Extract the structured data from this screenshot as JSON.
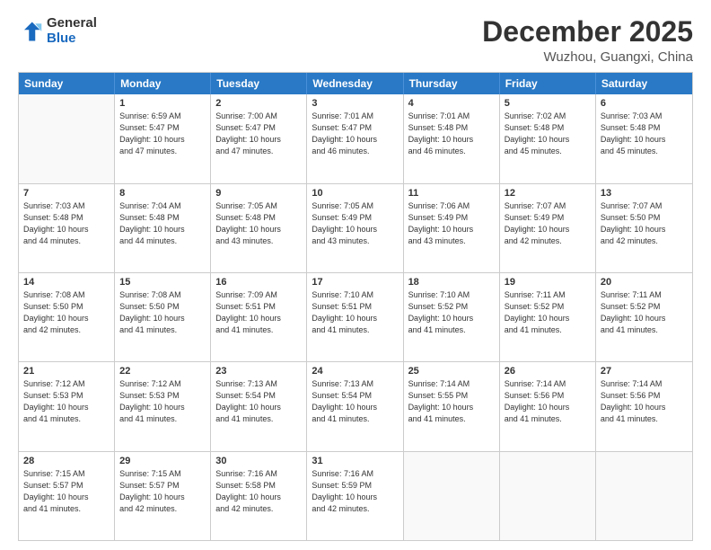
{
  "logo": {
    "general": "General",
    "blue": "Blue"
  },
  "header": {
    "month": "December 2025",
    "location": "Wuzhou, Guangxi, China"
  },
  "days": [
    "Sunday",
    "Monday",
    "Tuesday",
    "Wednesday",
    "Thursday",
    "Friday",
    "Saturday"
  ],
  "weeks": [
    [
      {
        "day": "",
        "info": ""
      },
      {
        "day": "1",
        "info": "Sunrise: 6:59 AM\nSunset: 5:47 PM\nDaylight: 10 hours\nand 47 minutes."
      },
      {
        "day": "2",
        "info": "Sunrise: 7:00 AM\nSunset: 5:47 PM\nDaylight: 10 hours\nand 47 minutes."
      },
      {
        "day": "3",
        "info": "Sunrise: 7:01 AM\nSunset: 5:47 PM\nDaylight: 10 hours\nand 46 minutes."
      },
      {
        "day": "4",
        "info": "Sunrise: 7:01 AM\nSunset: 5:48 PM\nDaylight: 10 hours\nand 46 minutes."
      },
      {
        "day": "5",
        "info": "Sunrise: 7:02 AM\nSunset: 5:48 PM\nDaylight: 10 hours\nand 45 minutes."
      },
      {
        "day": "6",
        "info": "Sunrise: 7:03 AM\nSunset: 5:48 PM\nDaylight: 10 hours\nand 45 minutes."
      }
    ],
    [
      {
        "day": "7",
        "info": "Sunrise: 7:03 AM\nSunset: 5:48 PM\nDaylight: 10 hours\nand 44 minutes."
      },
      {
        "day": "8",
        "info": "Sunrise: 7:04 AM\nSunset: 5:48 PM\nDaylight: 10 hours\nand 44 minutes."
      },
      {
        "day": "9",
        "info": "Sunrise: 7:05 AM\nSunset: 5:48 PM\nDaylight: 10 hours\nand 43 minutes."
      },
      {
        "day": "10",
        "info": "Sunrise: 7:05 AM\nSunset: 5:49 PM\nDaylight: 10 hours\nand 43 minutes."
      },
      {
        "day": "11",
        "info": "Sunrise: 7:06 AM\nSunset: 5:49 PM\nDaylight: 10 hours\nand 43 minutes."
      },
      {
        "day": "12",
        "info": "Sunrise: 7:07 AM\nSunset: 5:49 PM\nDaylight: 10 hours\nand 42 minutes."
      },
      {
        "day": "13",
        "info": "Sunrise: 7:07 AM\nSunset: 5:50 PM\nDaylight: 10 hours\nand 42 minutes."
      }
    ],
    [
      {
        "day": "14",
        "info": "Sunrise: 7:08 AM\nSunset: 5:50 PM\nDaylight: 10 hours\nand 42 minutes."
      },
      {
        "day": "15",
        "info": "Sunrise: 7:08 AM\nSunset: 5:50 PM\nDaylight: 10 hours\nand 41 minutes."
      },
      {
        "day": "16",
        "info": "Sunrise: 7:09 AM\nSunset: 5:51 PM\nDaylight: 10 hours\nand 41 minutes."
      },
      {
        "day": "17",
        "info": "Sunrise: 7:10 AM\nSunset: 5:51 PM\nDaylight: 10 hours\nand 41 minutes."
      },
      {
        "day": "18",
        "info": "Sunrise: 7:10 AM\nSunset: 5:52 PM\nDaylight: 10 hours\nand 41 minutes."
      },
      {
        "day": "19",
        "info": "Sunrise: 7:11 AM\nSunset: 5:52 PM\nDaylight: 10 hours\nand 41 minutes."
      },
      {
        "day": "20",
        "info": "Sunrise: 7:11 AM\nSunset: 5:52 PM\nDaylight: 10 hours\nand 41 minutes."
      }
    ],
    [
      {
        "day": "21",
        "info": "Sunrise: 7:12 AM\nSunset: 5:53 PM\nDaylight: 10 hours\nand 41 minutes."
      },
      {
        "day": "22",
        "info": "Sunrise: 7:12 AM\nSunset: 5:53 PM\nDaylight: 10 hours\nand 41 minutes."
      },
      {
        "day": "23",
        "info": "Sunrise: 7:13 AM\nSunset: 5:54 PM\nDaylight: 10 hours\nand 41 minutes."
      },
      {
        "day": "24",
        "info": "Sunrise: 7:13 AM\nSunset: 5:54 PM\nDaylight: 10 hours\nand 41 minutes."
      },
      {
        "day": "25",
        "info": "Sunrise: 7:14 AM\nSunset: 5:55 PM\nDaylight: 10 hours\nand 41 minutes."
      },
      {
        "day": "26",
        "info": "Sunrise: 7:14 AM\nSunset: 5:56 PM\nDaylight: 10 hours\nand 41 minutes."
      },
      {
        "day": "27",
        "info": "Sunrise: 7:14 AM\nSunset: 5:56 PM\nDaylight: 10 hours\nand 41 minutes."
      }
    ],
    [
      {
        "day": "28",
        "info": "Sunrise: 7:15 AM\nSunset: 5:57 PM\nDaylight: 10 hours\nand 41 minutes."
      },
      {
        "day": "29",
        "info": "Sunrise: 7:15 AM\nSunset: 5:57 PM\nDaylight: 10 hours\nand 42 minutes."
      },
      {
        "day": "30",
        "info": "Sunrise: 7:16 AM\nSunset: 5:58 PM\nDaylight: 10 hours\nand 42 minutes."
      },
      {
        "day": "31",
        "info": "Sunrise: 7:16 AM\nSunset: 5:59 PM\nDaylight: 10 hours\nand 42 minutes."
      },
      {
        "day": "",
        "info": ""
      },
      {
        "day": "",
        "info": ""
      },
      {
        "day": "",
        "info": ""
      }
    ]
  ]
}
